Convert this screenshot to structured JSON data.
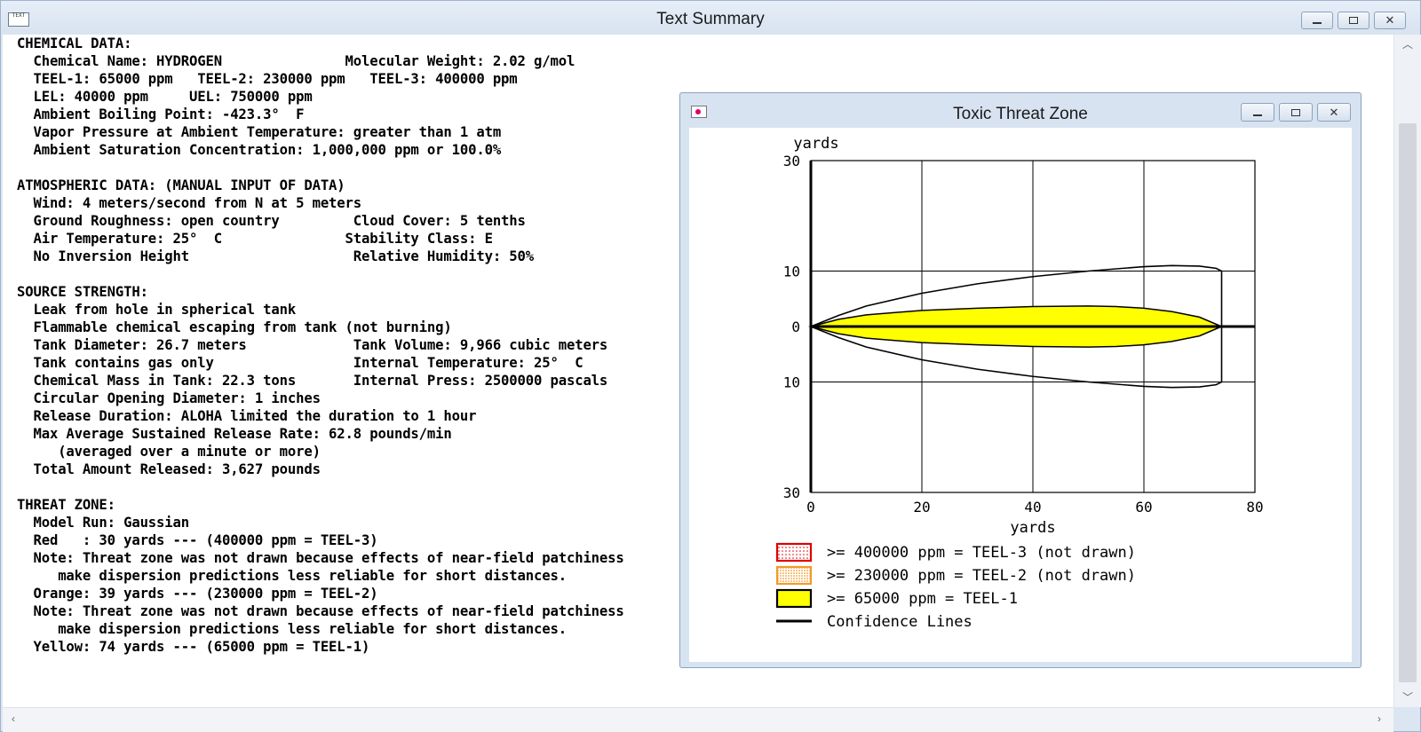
{
  "main_window": {
    "title": "Text Summary",
    "icon_label": "TEXT"
  },
  "summary_lines": [
    "CHEMICAL DATA:",
    "  Chemical Name: HYDROGEN               Molecular Weight: 2.02 g/mol",
    "  TEEL-1: 65000 ppm   TEEL-2: 230000 ppm   TEEL-3: 400000 ppm",
    "  LEL: 40000 ppm     UEL: 750000 ppm",
    "  Ambient Boiling Point: -423.3°  F",
    "  Vapor Pressure at Ambient Temperature: greater than 1 atm",
    "  Ambient Saturation Concentration: 1,000,000 ppm or 100.0%",
    "",
    "ATMOSPHERIC DATA: (MANUAL INPUT OF DATA)",
    "  Wind: 4 meters/second from N at 5 meters",
    "  Ground Roughness: open country         Cloud Cover: 5 tenths",
    "  Air Temperature: 25°  C               Stability Class: E",
    "  No Inversion Height                    Relative Humidity: 50%",
    "",
    "SOURCE STRENGTH:",
    "  Leak from hole in spherical tank",
    "  Flammable chemical escaping from tank (not burning)",
    "  Tank Diameter: 26.7 meters             Tank Volume: 9,966 cubic meters",
    "  Tank contains gas only                 Internal Temperature: 25°  C",
    "  Chemical Mass in Tank: 22.3 tons       Internal Press: 2500000 pascals",
    "  Circular Opening Diameter: 1 inches",
    "  Release Duration: ALOHA limited the duration to 1 hour",
    "  Max Average Sustained Release Rate: 62.8 pounds/min",
    "     (averaged over a minute or more)",
    "  Total Amount Released: 3,627 pounds",
    "",
    "THREAT ZONE:",
    "  Model Run: Gaussian",
    "  Red   : 30 yards --- (400000 ppm = TEEL-3)",
    "  Note: Threat zone was not drawn because effects of near-field patchiness",
    "     make dispersion predictions less reliable for short distances.",
    "  Orange: 39 yards --- (230000 ppm = TEEL-2)",
    "  Note: Threat zone was not drawn because effects of near-field patchiness",
    "     make dispersion predictions less reliable for short distances.",
    "  Yellow: 74 yards --- (65000 ppm = TEEL-1)"
  ],
  "threat_window": {
    "title": "Toxic Threat Zone"
  },
  "chart_data": {
    "type": "area",
    "ylabel": "yards",
    "xlabel": "yards",
    "xlim": [
      0,
      80
    ],
    "ylim": [
      -30,
      30
    ],
    "x_ticks": [
      0,
      20,
      40,
      60,
      80
    ],
    "y_ticks": [
      30,
      10,
      0,
      -10,
      -30
    ],
    "y_tick_labels": [
      "30",
      "10",
      "0",
      "10",
      "30"
    ],
    "grid": true,
    "threat_zone_yellow": {
      "x": [
        0,
        5,
        10,
        20,
        30,
        40,
        50,
        55,
        60,
        65,
        70,
        74
      ],
      "half_width": [
        0,
        1.3,
        2.1,
        2.9,
        3.3,
        3.6,
        3.7,
        3.6,
        3.3,
        2.7,
        1.7,
        0
      ]
    },
    "confidence_lines": {
      "x": [
        0,
        5,
        10,
        20,
        30,
        40,
        50,
        60,
        65,
        70,
        73,
        74
      ],
      "half_width": [
        0,
        2,
        3.7,
        6,
        7.7,
        9,
        10,
        10.8,
        11,
        10.9,
        10.5,
        10
      ]
    },
    "centerline_x": [
      0,
      80
    ],
    "legend": [
      {
        "label": ">= 400000 ppm = TEEL-3 (not drawn)",
        "swatch": "red-dotted",
        "color": "#e00000"
      },
      {
        "label": ">= 230000 ppm = TEEL-2 (not drawn)",
        "swatch": "orange-dotted",
        "color": "#f39a2b"
      },
      {
        "label": ">= 65000 ppm = TEEL-1",
        "swatch": "yellow-solid",
        "color": "#ffff00"
      },
      {
        "label": "Confidence Lines",
        "swatch": "line",
        "color": "#000000"
      }
    ]
  }
}
